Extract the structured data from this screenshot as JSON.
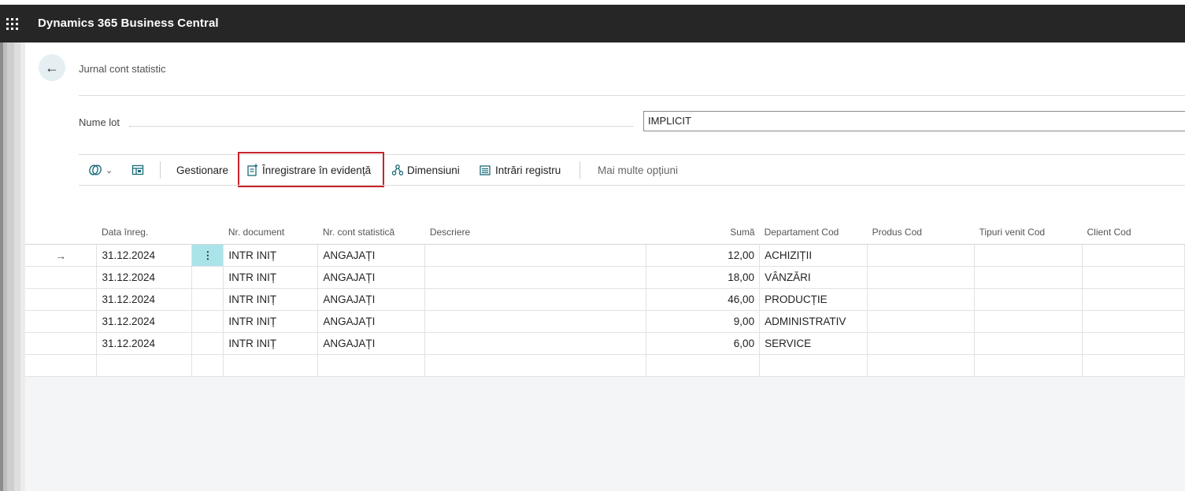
{
  "app": {
    "title": "Dynamics 365 Business Central"
  },
  "page": {
    "title": "Jurnal cont statistic",
    "back_icon": "arrow-left-icon"
  },
  "batch": {
    "label": "Nume lot",
    "value": "IMPLICIT"
  },
  "toolbar": {
    "gestionare": "Gestionare",
    "inregistrare": "Înregistrare în evidență",
    "dimensiuni": "Dimensiuni",
    "intrari": "Intrări registru",
    "mai_multe": "Mai multe opțiuni"
  },
  "columns": {
    "data": "Data înreg.",
    "nr_document": "Nr. document",
    "nr_cont": "Nr. cont statistică",
    "descriere": "Descriere",
    "suma": "Sumă",
    "departament": "Departament Cod",
    "produs": "Produs Cod",
    "tipuri": "Tipuri venit Cod",
    "client": "Client Cod"
  },
  "rows": [
    {
      "data": "31.12.2024",
      "nr_document": "INTR INIȚ",
      "nr_cont": "ANGAJAȚI",
      "descriere": "",
      "suma": "12,00",
      "departament": "ACHIZIȚII",
      "produs": "",
      "tipuri": "",
      "client": ""
    },
    {
      "data": "31.12.2024",
      "nr_document": "INTR INIȚ",
      "nr_cont": "ANGAJAȚI",
      "descriere": "",
      "suma": "18,00",
      "departament": "VÂNZĂRI",
      "produs": "",
      "tipuri": "",
      "client": ""
    },
    {
      "data": "31.12.2024",
      "nr_document": "INTR INIȚ",
      "nr_cont": "ANGAJAȚI",
      "descriere": "",
      "suma": "46,00",
      "departament": "PRODUCȚIE",
      "produs": "",
      "tipuri": "",
      "client": ""
    },
    {
      "data": "31.12.2024",
      "nr_document": "INTR INIȚ",
      "nr_cont": "ANGAJAȚI",
      "descriere": "",
      "suma": "9,00",
      "departament": "ADMINISTRATIV",
      "produs": "",
      "tipuri": "",
      "client": ""
    },
    {
      "data": "31.12.2024",
      "nr_document": "INTR INIȚ",
      "nr_cont": "ANGAJAȚI",
      "descriere": "",
      "suma": "6,00",
      "departament": "SERVICE",
      "produs": "",
      "tipuri": "",
      "client": ""
    }
  ],
  "colors": {
    "topbar": "#262626",
    "accent": "#1a6b7a",
    "highlight": "#c8232c",
    "active_cell": "#a9e4ea"
  }
}
